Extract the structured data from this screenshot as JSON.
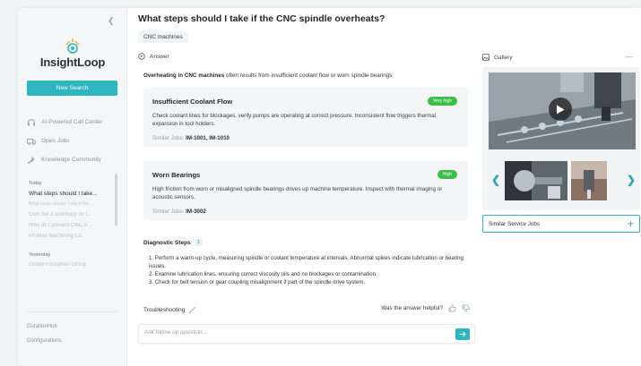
{
  "sidebar": {
    "logo_text": "InsightLoop",
    "new_search_label": "New Search",
    "nav": [
      {
        "label": "AI-Powered Call Center",
        "icon": "headset-icon"
      },
      {
        "label": "Open Jobs",
        "icon": "truck-icon"
      },
      {
        "label": "Knowledge Community",
        "icon": "community-icon"
      }
    ],
    "history": {
      "today_label": "Today",
      "today_items": [
        "What steps should I take...",
        "What steps should I take if the ...",
        "Give me a summary on f...",
        "How do I prevent CNC o...",
        "ProMax Machining Co."
      ],
      "yesterday_label": "Yesterday",
      "yesterday_items": [
        "Global Foundries Group"
      ]
    },
    "bottom_links": [
      "CurationHub",
      "Configurations"
    ]
  },
  "main": {
    "question": "What steps should I take if the CNC spindle overheats?",
    "tag": "CNC machines",
    "answer_label": "Answer",
    "intro_bold": "Overheating in CNC machines",
    "intro_rest": " often results from insufficient coolant flow or worn spindle bearings.",
    "cards": [
      {
        "title": "Insufficient Coolant Flow",
        "badge": "Very high",
        "desc": "Check coolant lines for blockages, verify pumps are operating at correct pressure. Inconsistent flow triggers thermal expansion in tool holders.",
        "similar_label": "Similar Jobs:",
        "similar_jobs": "IM-1001, IM-1010"
      },
      {
        "title": "Worn Bearings",
        "badge": "High",
        "desc": "High friction from worn or misaligned spindle bearings drives up machine temperature. Inspect with thermal imaging or acoustic sensors.",
        "similar_label": "Similar Jobs:",
        "similar_jobs": "IM-3002"
      }
    ],
    "diagnostic_label": "Diagnostic Steps",
    "diagnostic_count": "1",
    "steps": [
      "1. Perform a warm-up cycle, measuring spindle or coolant temperature at intervals. Abnormal spikes indicate lubrication or bearing issues.",
      "2. Examine lubrication lines, ensuring correct viscosity oils and no blockages or contamination.",
      "3. Check for belt tension or gear coupling misalignment if part of the spindle drive system."
    ],
    "troubleshooting_label": "Troubleshooting",
    "helpful_label": "Was the answer helpful?",
    "ask_placeholder": "Ask follow up question..."
  },
  "right": {
    "gallery_label": "Gallery",
    "similar_service_jobs_label": "Similar Service Jobs"
  },
  "colors": {
    "accent": "#2fb5c0",
    "badge_green": "#3cbf46"
  }
}
